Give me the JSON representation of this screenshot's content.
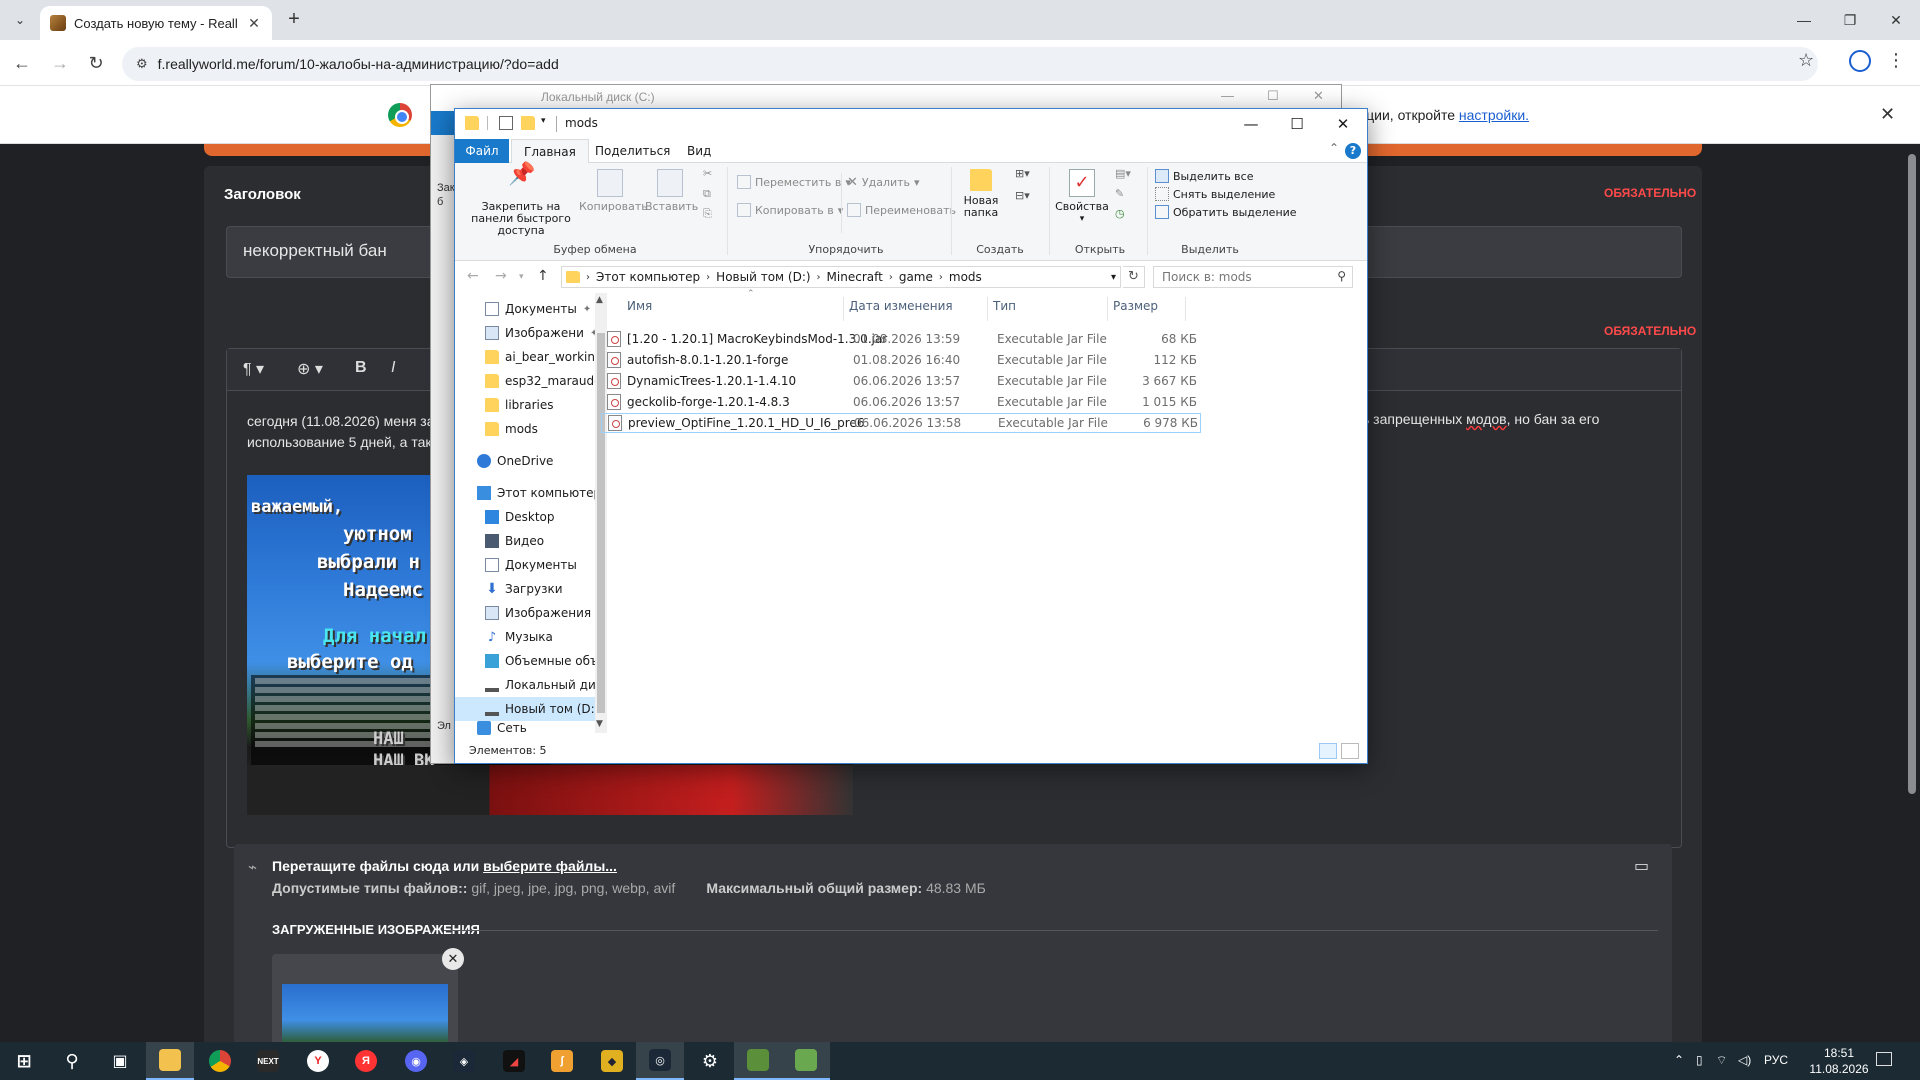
{
  "browser": {
    "tab_title": "Создать новую тему - ReallyW",
    "url": "f.reallyworld.me/forum/10-жалобы-на-администрацию/?do=add",
    "info_bar_text": "кции, откройте",
    "info_bar_link": "настройки."
  },
  "forum": {
    "title_label": "Заголовок",
    "required_label": "ОБЯЗАТЕЛЬНО",
    "title_value": "некорректный бан",
    "body_line1": "сегодня (11.08.2026) меня за",
    "body_line2": "использование 5 дней, а так",
    "body_right_pre": "ь запрещенных",
    "body_right_word": "модов",
    "body_right_post": ", но бан за его",
    "image_lines": [
      "важаемый, ",
      "уютном ",
      "выбрали н",
      "Надеемс",
      "Для начал",
      "выберите од",
      "НАШ",
      "НАШ ВК"
    ],
    "upload_drop_text": "Перетащите файлы сюда или ",
    "upload_drop_link": "выберите файлы...",
    "upload_types_label": "Допустимые типы файлов:: ",
    "upload_types_value": "gif, jpeg, jpe, jpg, png, webp, avif",
    "upload_max_label": "Максимальный общий размер: ",
    "upload_max_value": "48.83 МБ",
    "uploaded_heading": "ЗАГРУЖЕННЫЕ ИЗОБРАЖЕНИЯ"
  },
  "explorer_back": {
    "title": "Локальный диск (C:)",
    "side_fragments": [
      "Закр",
      "б",
      "Эл"
    ]
  },
  "explorer": {
    "title": "mods",
    "tabs": {
      "file": "Файл",
      "home": "Главная",
      "share": "Поделиться",
      "view": "Вид"
    },
    "ribbon": {
      "pin": "Закрепить на панели быстрого доступа",
      "copy": "Копировать",
      "paste": "Вставить",
      "clipboard_group": "Буфер обмена",
      "move_to": "Переместить в",
      "copy_to": "Копировать в",
      "delete": "Удалить",
      "rename": "Переименовать",
      "organize_group": "Упорядочить",
      "new_folder": "Новая папка",
      "create_group": "Создать",
      "properties": "Свойства",
      "open_group": "Открыть",
      "select_all": "Выделить все",
      "select_none": "Снять выделение",
      "invert_selection": "Обратить выделение",
      "select_group": "Выделить"
    },
    "breadcrumb": [
      "Этот компьютер",
      "Новый том (D:)",
      "Minecraft",
      "game",
      "mods"
    ],
    "search_placeholder": "Поиск в: mods",
    "nav": [
      {
        "label": "Документы",
        "pinned": true
      },
      {
        "label": "Изображени",
        "pinned": true
      },
      {
        "label": "ai_bear_working"
      },
      {
        "label": "esp32_marauder"
      },
      {
        "label": "libraries"
      },
      {
        "label": "mods"
      },
      {
        "label": "OneDrive"
      },
      {
        "label": "Этот компьютер"
      },
      {
        "label": "Desktop"
      },
      {
        "label": "Видео"
      },
      {
        "label": "Документы"
      },
      {
        "label": "Загрузки"
      },
      {
        "label": "Изображения"
      },
      {
        "label": "Музыка"
      },
      {
        "label": "Объемные объ"
      },
      {
        "label": "Локальный дис"
      },
      {
        "label": "Новый том (D:)"
      },
      {
        "label": "Сеть"
      }
    ],
    "columns": {
      "name": "Имя",
      "date": "Дата изменения",
      "type": "Тип",
      "size": "Размер"
    },
    "files": [
      {
        "name": "[1.20 - 1.20.1] MacroKeybindsMod-1.3.0.jar",
        "date": "01.08.2026 13:59",
        "type": "Executable Jar File",
        "size": "68 КБ"
      },
      {
        "name": "autofish-8.0.1-1.20.1-forge",
        "date": "01.08.2026 16:40",
        "type": "Executable Jar File",
        "size": "112 КБ"
      },
      {
        "name": "DynamicTrees-1.20.1-1.4.10",
        "date": "06.06.2026 13:57",
        "type": "Executable Jar File",
        "size": "3 667 КБ"
      },
      {
        "name": "geckolib-forge-1.20.1-4.8.3",
        "date": "06.06.2026 13:57",
        "type": "Executable Jar File",
        "size": "1 015 КБ"
      },
      {
        "name": "preview_OptiFine_1.20.1_HD_U_I6_pre6",
        "date": "06.06.2026 13:58",
        "type": "Executable Jar File",
        "size": "6 978 КБ"
      }
    ],
    "status": "Элементов: 5"
  },
  "taskbar": {
    "lang": "РУС",
    "time": "18:51",
    "date": "11.08.2026"
  },
  "colors": {
    "chrome_bg": "#dfe3e8",
    "page_bg": "#1f2125",
    "accent_orange": "#e0672e",
    "required_red": "#ff4a4a",
    "explorer_blue": "#1979ca",
    "taskbar": "#1b2a33"
  }
}
